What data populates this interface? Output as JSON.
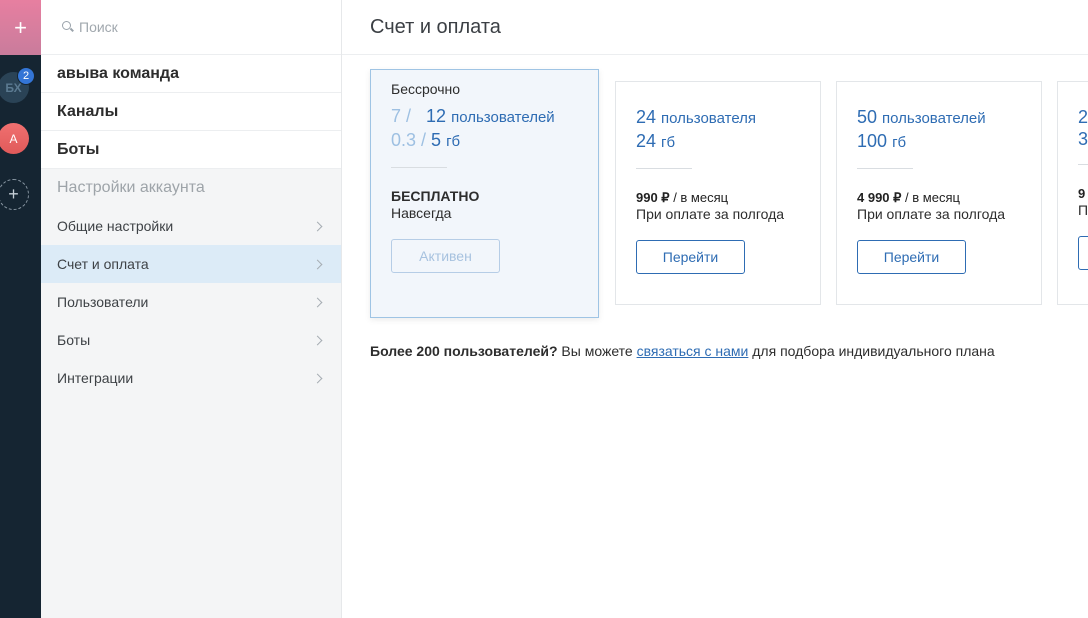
{
  "rail": {
    "add_icon": "plus-icon",
    "workspaces": [
      {
        "initials": "БХ",
        "badge": "2"
      },
      {
        "initials": "А"
      }
    ],
    "new_icon": "plus-icon"
  },
  "sidebar": {
    "search_placeholder": "Поиск",
    "team_name": "авыва команда",
    "channels_label": "Каналы",
    "bots_label": "Боты",
    "account_settings_label": "Настройки аккаунта",
    "items": [
      {
        "label": "Общие настройки"
      },
      {
        "label": "Счет и оплата",
        "active": true
      },
      {
        "label": "Пользователи"
      },
      {
        "label": "Боты"
      },
      {
        "label": "Интеграции"
      }
    ]
  },
  "main": {
    "title": "Счет и оплата",
    "plans": [
      {
        "period": "Бессрочно",
        "users_used": "7 /",
        "users_total": "12",
        "users_unit": "пользователей",
        "storage_used": "0.3 /",
        "storage_total": "5",
        "storage_unit": "гб",
        "price_label": "БЕСПЛАТНО",
        "note": "Навсегда",
        "button": "Активен"
      },
      {
        "users_total": "24",
        "users_unit": "пользователя",
        "storage_total": "24",
        "storage_unit": "гб",
        "price": "990 ₽",
        "price_suffix": " / в месяц",
        "note": "При оплате за полгода",
        "button": "Перейти"
      },
      {
        "users_total": "50",
        "users_unit": "пользователей",
        "storage_total": "100",
        "storage_unit": "гб",
        "price": "4 990 ₽",
        "price_suffix": " / в месяц",
        "note": "При оплате за полгода",
        "button": "Перейти"
      },
      {
        "users_total": "2",
        "storage_total": "3",
        "price": "9",
        "note": "П"
      }
    ],
    "footer": {
      "bold": "Более 200 пользователей?",
      "text1": " Вы можете ",
      "link": "связаться с нами",
      "text2": " для подбора индивидуального плана"
    }
  },
  "colors": {
    "rail_bg": "#152532",
    "accent": "#2e6cb3",
    "active_nav": "#dcebf7"
  }
}
